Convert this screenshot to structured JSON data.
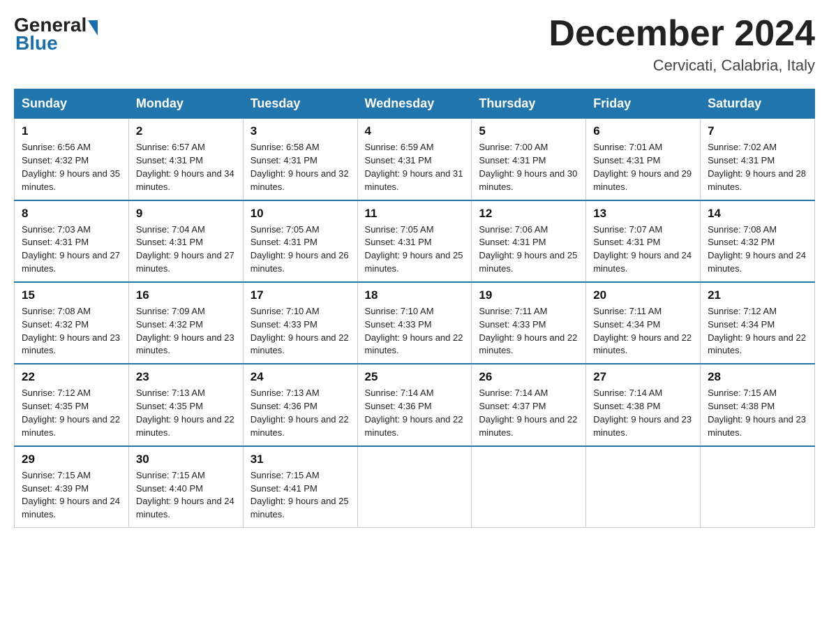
{
  "header": {
    "logo_general": "General",
    "logo_blue": "Blue",
    "month_title": "December 2024",
    "location": "Cervicati, Calabria, Italy"
  },
  "days_of_week": [
    "Sunday",
    "Monday",
    "Tuesday",
    "Wednesday",
    "Thursday",
    "Friday",
    "Saturday"
  ],
  "weeks": [
    [
      {
        "day": "1",
        "sunrise": "6:56 AM",
        "sunset": "4:32 PM",
        "daylight": "9 hours and 35 minutes."
      },
      {
        "day": "2",
        "sunrise": "6:57 AM",
        "sunset": "4:31 PM",
        "daylight": "9 hours and 34 minutes."
      },
      {
        "day": "3",
        "sunrise": "6:58 AM",
        "sunset": "4:31 PM",
        "daylight": "9 hours and 32 minutes."
      },
      {
        "day": "4",
        "sunrise": "6:59 AM",
        "sunset": "4:31 PM",
        "daylight": "9 hours and 31 minutes."
      },
      {
        "day": "5",
        "sunrise": "7:00 AM",
        "sunset": "4:31 PM",
        "daylight": "9 hours and 30 minutes."
      },
      {
        "day": "6",
        "sunrise": "7:01 AM",
        "sunset": "4:31 PM",
        "daylight": "9 hours and 29 minutes."
      },
      {
        "day": "7",
        "sunrise": "7:02 AM",
        "sunset": "4:31 PM",
        "daylight": "9 hours and 28 minutes."
      }
    ],
    [
      {
        "day": "8",
        "sunrise": "7:03 AM",
        "sunset": "4:31 PM",
        "daylight": "9 hours and 27 minutes."
      },
      {
        "day": "9",
        "sunrise": "7:04 AM",
        "sunset": "4:31 PM",
        "daylight": "9 hours and 27 minutes."
      },
      {
        "day": "10",
        "sunrise": "7:05 AM",
        "sunset": "4:31 PM",
        "daylight": "9 hours and 26 minutes."
      },
      {
        "day": "11",
        "sunrise": "7:05 AM",
        "sunset": "4:31 PM",
        "daylight": "9 hours and 25 minutes."
      },
      {
        "day": "12",
        "sunrise": "7:06 AM",
        "sunset": "4:31 PM",
        "daylight": "9 hours and 25 minutes."
      },
      {
        "day": "13",
        "sunrise": "7:07 AM",
        "sunset": "4:31 PM",
        "daylight": "9 hours and 24 minutes."
      },
      {
        "day": "14",
        "sunrise": "7:08 AM",
        "sunset": "4:32 PM",
        "daylight": "9 hours and 24 minutes."
      }
    ],
    [
      {
        "day": "15",
        "sunrise": "7:08 AM",
        "sunset": "4:32 PM",
        "daylight": "9 hours and 23 minutes."
      },
      {
        "day": "16",
        "sunrise": "7:09 AM",
        "sunset": "4:32 PM",
        "daylight": "9 hours and 23 minutes."
      },
      {
        "day": "17",
        "sunrise": "7:10 AM",
        "sunset": "4:33 PM",
        "daylight": "9 hours and 22 minutes."
      },
      {
        "day": "18",
        "sunrise": "7:10 AM",
        "sunset": "4:33 PM",
        "daylight": "9 hours and 22 minutes."
      },
      {
        "day": "19",
        "sunrise": "7:11 AM",
        "sunset": "4:33 PM",
        "daylight": "9 hours and 22 minutes."
      },
      {
        "day": "20",
        "sunrise": "7:11 AM",
        "sunset": "4:34 PM",
        "daylight": "9 hours and 22 minutes."
      },
      {
        "day": "21",
        "sunrise": "7:12 AM",
        "sunset": "4:34 PM",
        "daylight": "9 hours and 22 minutes."
      }
    ],
    [
      {
        "day": "22",
        "sunrise": "7:12 AM",
        "sunset": "4:35 PM",
        "daylight": "9 hours and 22 minutes."
      },
      {
        "day": "23",
        "sunrise": "7:13 AM",
        "sunset": "4:35 PM",
        "daylight": "9 hours and 22 minutes."
      },
      {
        "day": "24",
        "sunrise": "7:13 AM",
        "sunset": "4:36 PM",
        "daylight": "9 hours and 22 minutes."
      },
      {
        "day": "25",
        "sunrise": "7:14 AM",
        "sunset": "4:36 PM",
        "daylight": "9 hours and 22 minutes."
      },
      {
        "day": "26",
        "sunrise": "7:14 AM",
        "sunset": "4:37 PM",
        "daylight": "9 hours and 22 minutes."
      },
      {
        "day": "27",
        "sunrise": "7:14 AM",
        "sunset": "4:38 PM",
        "daylight": "9 hours and 23 minutes."
      },
      {
        "day": "28",
        "sunrise": "7:15 AM",
        "sunset": "4:38 PM",
        "daylight": "9 hours and 23 minutes."
      }
    ],
    [
      {
        "day": "29",
        "sunrise": "7:15 AM",
        "sunset": "4:39 PM",
        "daylight": "9 hours and 24 minutes."
      },
      {
        "day": "30",
        "sunrise": "7:15 AM",
        "sunset": "4:40 PM",
        "daylight": "9 hours and 24 minutes."
      },
      {
        "day": "31",
        "sunrise": "7:15 AM",
        "sunset": "4:41 PM",
        "daylight": "9 hours and 25 minutes."
      },
      null,
      null,
      null,
      null
    ]
  ]
}
